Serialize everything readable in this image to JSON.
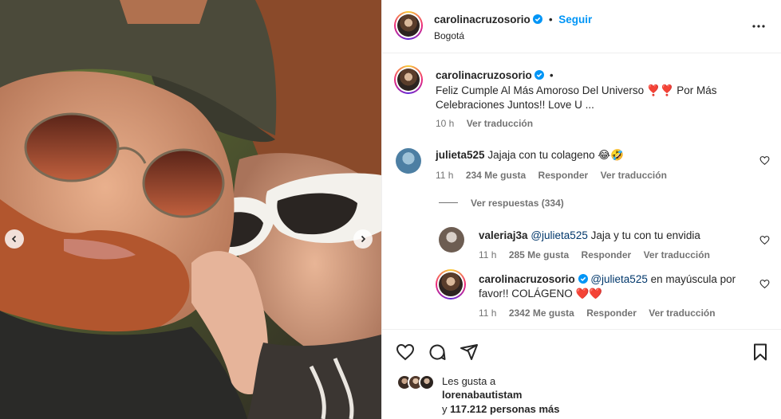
{
  "post": {
    "author": "carolinacruzosorio",
    "follow_label": "Seguir",
    "separator": "•",
    "location": "Bogotá"
  },
  "caption": {
    "author": "carolinacruzosorio",
    "separator": "•",
    "text": "Feliz Cumple Al Más Amoroso Del Universo ❣️❣️ Por Más Celebraciones Juntos!! Love U ...",
    "time": "10 h",
    "translate": "Ver traducción"
  },
  "comments": [
    {
      "user": "julieta525",
      "text": "Jajaja con tu colageno 😂🤣",
      "time": "11 h",
      "likes": "234 Me gusta",
      "reply": "Responder",
      "translate": "Ver traducción"
    }
  ],
  "view_replies": "Ver respuestas (334)",
  "replies": [
    {
      "user": "valeriaj3a",
      "mention": "@julieta525",
      "text": " Jaja y tu con tu envidia",
      "time": "11 h",
      "likes": "285 Me gusta",
      "reply": "Responder",
      "translate": "Ver traducción"
    },
    {
      "user": "carolinacruzosorio",
      "mention": "@julieta525",
      "text_line1": " en mayúscula por",
      "text_line2": "favor!! COLÁGENO ❤️❤️",
      "time": "11 h",
      "likes": "2342 Me gusta",
      "reply": "Responder",
      "translate": "Ver traducción"
    }
  ],
  "likes": {
    "prefix": "Les gusta a",
    "user": "lorenabautistam",
    "and": "y",
    "count": "117.212",
    "suffix": "personas más"
  },
  "icons": [
    "verified-icon",
    "more-icon",
    "heart-icon",
    "comment-icon",
    "share-icon",
    "bookmark-icon",
    "chevron-left-icon",
    "chevron-right-icon"
  ],
  "colors": {
    "link": "#0095f6",
    "mention": "#00376b",
    "muted": "#737373",
    "verified": "#0095f6"
  }
}
